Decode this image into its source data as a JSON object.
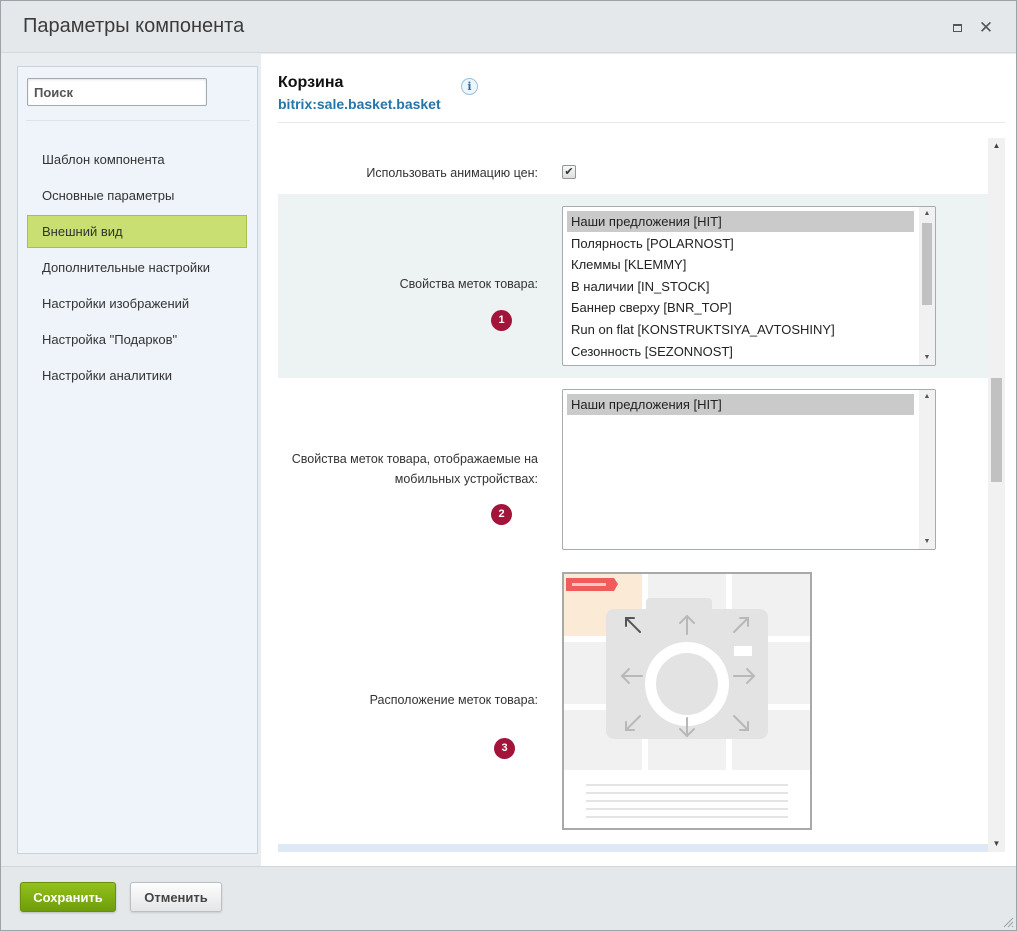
{
  "dialog": {
    "title": "Параметры компонента"
  },
  "sidebar": {
    "search_placeholder": "Поиск",
    "items": [
      {
        "label": "Шаблон компонента"
      },
      {
        "label": "Основные параметры"
      },
      {
        "label": "Внешний вид",
        "active": true
      },
      {
        "label": "Дополнительные настройки"
      },
      {
        "label": "Настройки изображений"
      },
      {
        "label": "Настройка \"Подарков\""
      },
      {
        "label": "Настройки аналитики"
      }
    ]
  },
  "component": {
    "title": "Корзина",
    "code": "bitrix:sale.basket.basket",
    "info_icon": "i"
  },
  "fields": {
    "price_animation": {
      "label": "Использовать анимацию цен:",
      "checked": true,
      "check_glyph": "✔"
    },
    "label_props": {
      "label": "Свойства меток товара:",
      "badge": "1",
      "options": [
        {
          "text": "Наши предложения [HIT]",
          "selected": true
        },
        {
          "text": "Полярность [POLARNOST]",
          "selected": false
        },
        {
          "text": "Клеммы [KLEMMY]",
          "selected": false
        },
        {
          "text": "В наличии [IN_STOCK]",
          "selected": false
        },
        {
          "text": "Баннер сверху [BNR_TOP]",
          "selected": false
        },
        {
          "text": "Run on flat [KONSTRUKTSIYA_AVTOSHINY]",
          "selected": false
        },
        {
          "text": "Сезонность [SEZONNOST]",
          "selected": false
        }
      ]
    },
    "label_props_mobile": {
      "label_line1": "Свойства меток товара, отображаемые на",
      "label_line2": "мобильных устройствах:",
      "badge": "2",
      "options": [
        {
          "text": "Наши предложения [HIT]",
          "selected": true
        }
      ]
    },
    "label_position": {
      "label": "Расположение меток товара:",
      "badge": "3",
      "selected_position": "top-left"
    }
  },
  "footer": {
    "save_label": "Сохранить",
    "cancel_label": "Отменить"
  },
  "glyphs": {
    "close": "✕",
    "scroll_up": "▲",
    "scroll_down": "▼"
  },
  "colors": {
    "active_item": "#c9df72",
    "link_blue": "#2475a8",
    "badge_red": "#a3143a",
    "save_green": "#7cab12",
    "label_marker": "#f05b5b",
    "selected_cell": "#fbebd6"
  }
}
